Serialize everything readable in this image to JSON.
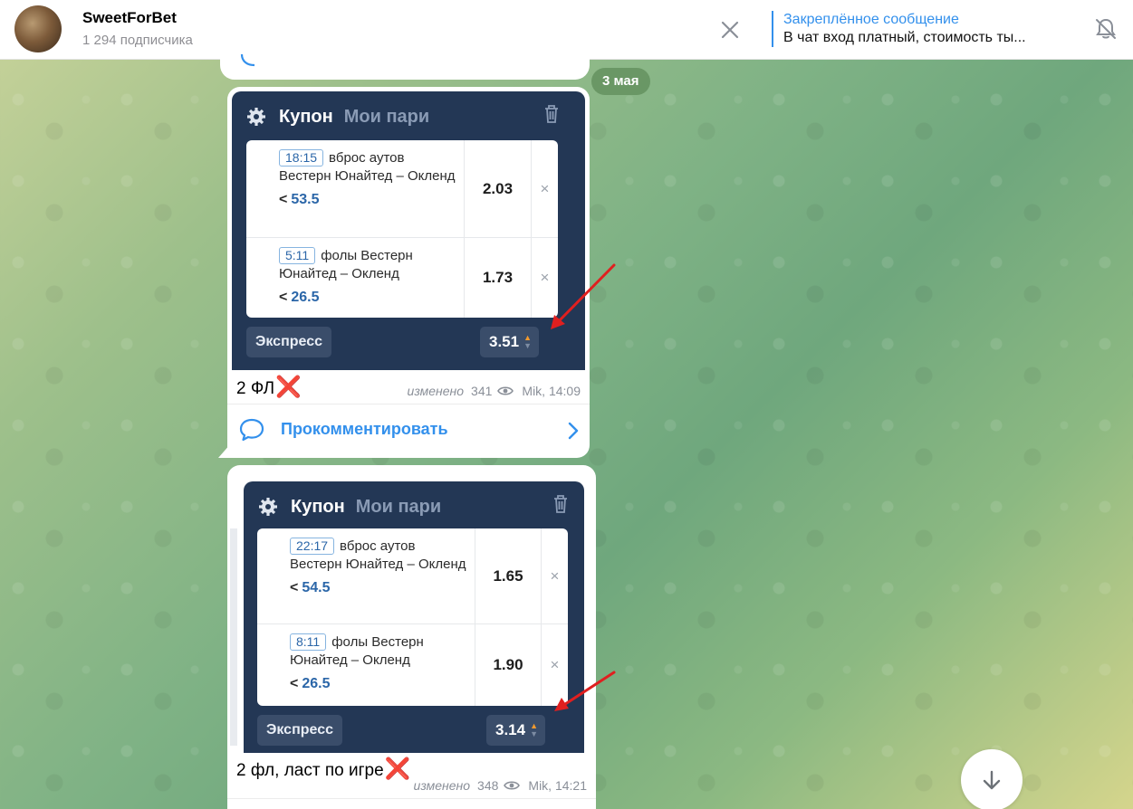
{
  "header": {
    "channel_name": "SweetForBet",
    "subscribers": "1 294 подписчика",
    "pinned_title": "Закреплённое сообщение",
    "pinned_text": "В чат вход платный, стоимость ты..."
  },
  "date_badge": "3 мая",
  "messages": [
    {
      "coupon": {
        "title": "Купон",
        "tab": "Мои пари",
        "bets": [
          {
            "time": "18:15",
            "market": "вброс аутов",
            "match": "Вестерн Юнайтед – Окленд",
            "line_prefix": "<",
            "line": "53.5",
            "odd": "2.03"
          },
          {
            "time": "5:11",
            "market": "фолы Вестерн",
            "match": "Юнайтед – Окленд",
            "line_prefix": "<",
            "line": "26.5",
            "odd": "1.73"
          }
        ],
        "express_label": "Экспресс",
        "total_odd": "3.51"
      },
      "caption": "2 ФЛ",
      "caption_mark": "❌",
      "edited": "изменено",
      "views": "341",
      "author_time": "Mik, 14:09",
      "comment_label": "Прокомментировать"
    },
    {
      "coupon": {
        "title": "Купон",
        "tab": "Мои пари",
        "bets": [
          {
            "time": "22:17",
            "market": "вброс аутов",
            "match": "Вестерн Юнайтед – Окленд",
            "line_prefix": "<",
            "line": "54.5",
            "odd": "1.65"
          },
          {
            "time": "8:11",
            "market": "фолы Вестерн",
            "match": "Юнайтед – Окленд",
            "line_prefix": "<",
            "line": "26.5",
            "odd": "1.90"
          }
        ],
        "express_label": "Экспресс",
        "total_odd": "3.14"
      },
      "caption": "2 фл, ласт по игре",
      "caption_mark": "❌",
      "edited": "изменено",
      "views": "348",
      "author_time": "Mik, 14:21"
    }
  ],
  "colors": {
    "accent": "#3390ec",
    "coupon_bg": "#233755",
    "bet_blue": "#2b66a8",
    "cross_red": "#e0243a",
    "arrow_red": "#e01f1f"
  },
  "icons": [
    "close-icon",
    "bell-off-icon",
    "gear-icon",
    "trash-icon",
    "eye-icon",
    "comment-icon",
    "chevron-right-icon",
    "arrow-down-icon"
  ]
}
